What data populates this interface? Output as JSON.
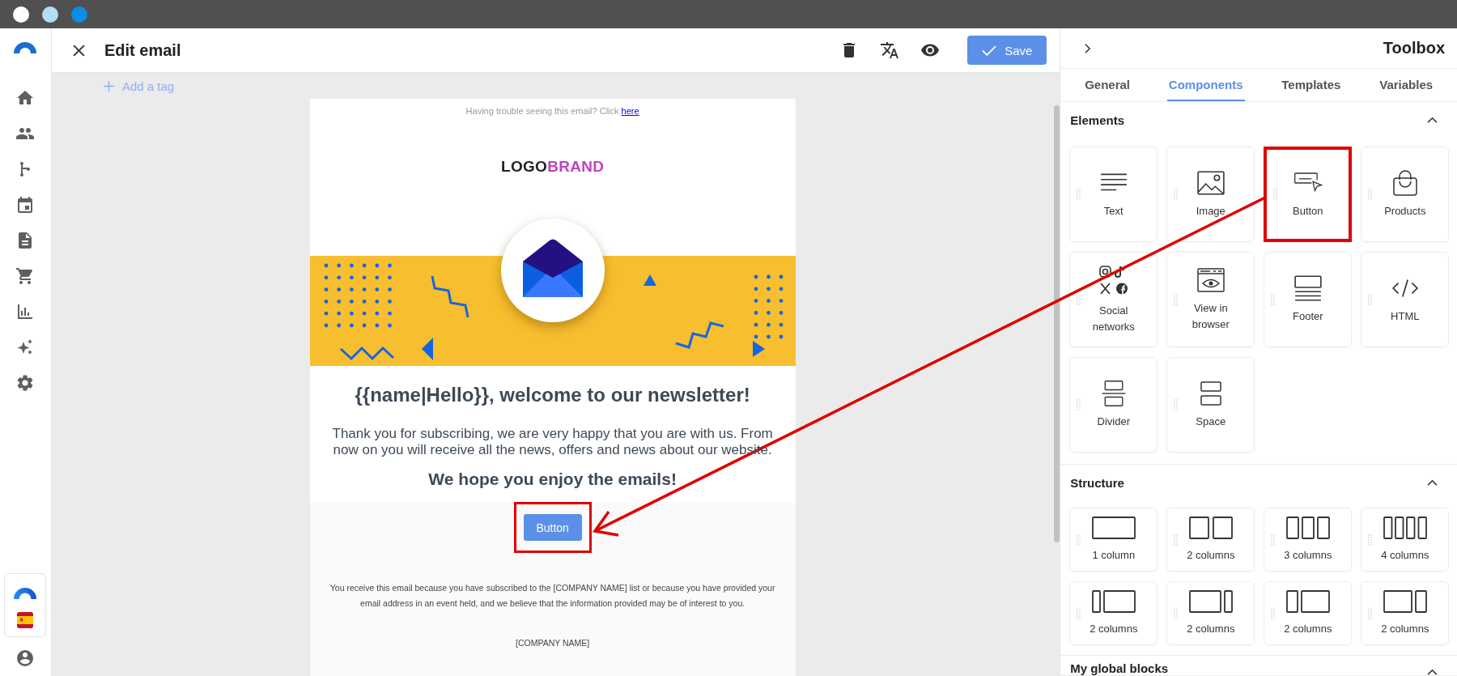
{
  "window_dots": [
    {
      "color": "#ffffff"
    },
    {
      "color": "#b3dcf5"
    },
    {
      "color": "#0b8ee8"
    }
  ],
  "header": {
    "title": "Edit email",
    "save_label": "Save"
  },
  "add_tag": "Add a tag",
  "email": {
    "preheader": "Having trouble seeing this email? Click",
    "preheader_link": "here",
    "logo_dark": "LOGO",
    "logo_accent": "BRAND",
    "heading": "{{name|Hello}}, welcome to our newsletter!",
    "body": "Thank you for subscribing, we are very happy that you are with us. From now on you will receive all the news, offers and news about our website.",
    "subheading": "We hope you enjoy the emails!",
    "button": {
      "label": "Button",
      "highlighted": true
    },
    "footer_note": "You receive this email because you have subscribed to the [COMPANY NAME] list or because you have provided your email address in an event held, and we believe that the information provided may be of interest to you.",
    "company": "[COMPANY NAME]"
  },
  "toolbox": {
    "title": "Toolbox",
    "tabs": [
      {
        "label": "General",
        "selected": false
      },
      {
        "label": "Components",
        "selected": true
      },
      {
        "label": "Templates",
        "selected": false
      },
      {
        "label": "Variables",
        "selected": false
      }
    ],
    "sections": [
      {
        "title": "Elements",
        "expanded": true,
        "items": [
          {
            "label": "Text",
            "kind": "text",
            "highlighted": false
          },
          {
            "label": "Image",
            "kind": "image",
            "highlighted": false
          },
          {
            "label": "Button",
            "kind": "button",
            "highlighted": true
          },
          {
            "label": "Products",
            "kind": "products",
            "highlighted": false
          },
          {
            "label": "Social networks",
            "kind": "social",
            "highlighted": false
          },
          {
            "label": "View in browser",
            "kind": "browser",
            "highlighted": false
          },
          {
            "label": "Footer",
            "kind": "footer",
            "highlighted": false
          },
          {
            "label": "HTML",
            "kind": "html",
            "highlighted": false
          },
          {
            "label": "Divider",
            "kind": "divider",
            "highlighted": false
          },
          {
            "label": "Space",
            "kind": "space",
            "highlighted": false
          }
        ]
      },
      {
        "title": "Structure",
        "expanded": true,
        "items": [
          {
            "label": "1 column",
            "kind": "col1"
          },
          {
            "label": "2 columns",
            "kind": "col2"
          },
          {
            "label": "3 columns",
            "kind": "col3"
          },
          {
            "label": "4 columns",
            "kind": "col4"
          },
          {
            "label": "2 columns",
            "kind": "split14"
          },
          {
            "label": "2 columns",
            "kind": "split41"
          },
          {
            "label": "2 columns",
            "kind": "split13"
          },
          {
            "label": "2 columns",
            "kind": "split31"
          }
        ]
      },
      {
        "title": "My global blocks",
        "expanded": true
      }
    ]
  }
}
